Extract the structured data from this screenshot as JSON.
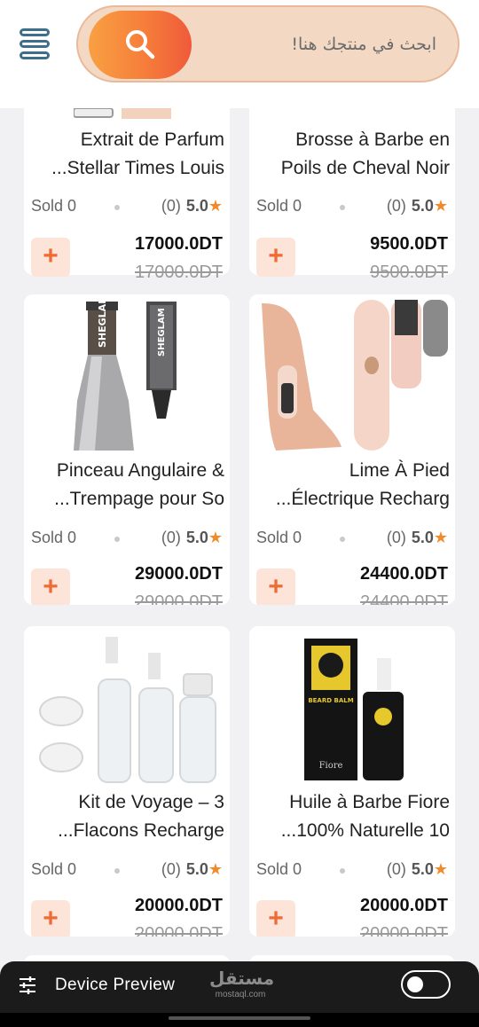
{
  "header": {
    "search_placeholder": "ابحث في منتجك هنا!"
  },
  "top_row": [
    {
      "title_line1": "Extrait de Parfum",
      "title_line2": "...Stellar Times Louis",
      "sold": "Sold 0",
      "rating_count": "(0)",
      "rating": "5.0",
      "price": "17000.0DT",
      "old_price": "17000.0DT"
    },
    {
      "title_line1": "Brosse à Barbe en",
      "title_line2": "Poils de Cheval Noir",
      "sold": "Sold 0",
      "rating_count": "(0)",
      "rating": "5.0",
      "price": "9500.0DT",
      "old_price": "9500.0DT"
    }
  ],
  "products": [
    {
      "title_line1": "Pinceau Angulaire &",
      "title_line2": "...Trempage pour So",
      "sold": "Sold 0",
      "rating_count": "(0)",
      "rating": "5.0",
      "price": "29000.0DT",
      "old_price": "29000.0DT",
      "image_text": "SHEGLAM"
    },
    {
      "title_line1": "Lime À Pied",
      "title_line2": "...Électrique Recharg",
      "sold": "Sold 0",
      "rating_count": "(0)",
      "rating": "5.0",
      "price": "24400.0DT",
      "old_price": "24400.0DT"
    },
    {
      "title_line1": "Kit de Voyage – 3",
      "title_line2": "...Flacons Recharge",
      "sold": "Sold 0",
      "rating_count": "(0)",
      "rating": "5.0",
      "price": "20000.0DT",
      "old_price": "20000.0DT"
    },
    {
      "title_line1": "Huile à Barbe Fiore",
      "title_line2": "...100% Naturelle 10",
      "sold": "Sold 0",
      "rating_count": "(0)",
      "rating": "5.0",
      "price": "20000.0DT",
      "old_price": "20000.0DT",
      "image_text": "BEARD BALM",
      "image_brand": "Fiore"
    }
  ],
  "add_label": "+",
  "star": "★",
  "bottom_bar": {
    "label": "Device Preview",
    "watermark_ar": "مستقل",
    "watermark_en": "mostaql.com",
    "toggle_on": false
  },
  "colors": {
    "accent": "#f57a3a",
    "search_bg": "#f3d9c4",
    "menu_icon": "#3d6e8a",
    "star": "#f08a2a",
    "add_bg": "#fde4d8"
  }
}
